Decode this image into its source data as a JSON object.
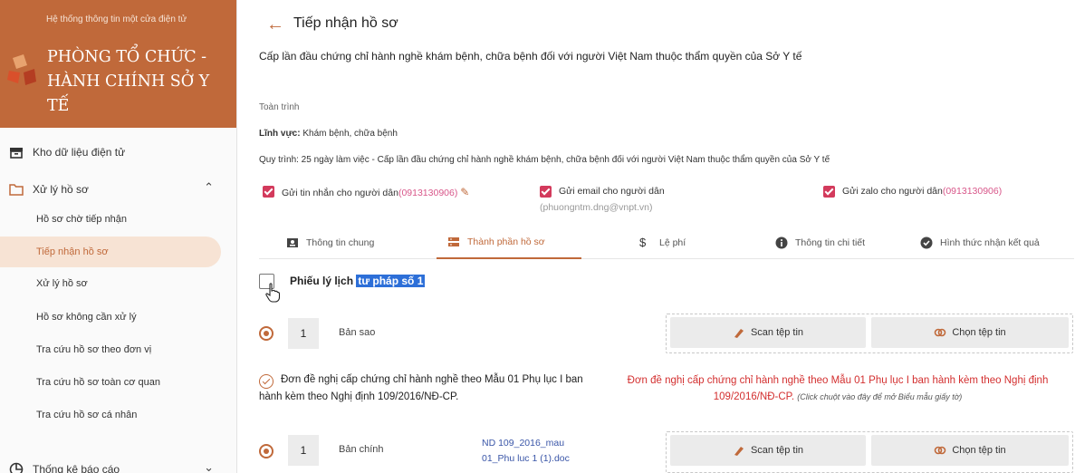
{
  "sidebar": {
    "system_name": "Hệ thống thông tin một cửa điện tử",
    "org_name": "PHÒNG TỔ CHỨC - HÀNH CHÍNH SỞ Y TẾ",
    "items": [
      {
        "label": "Kho dữ liệu điện tử",
        "icon": "archive-icon"
      },
      {
        "label": "Xử lý hồ sơ",
        "icon": "folder-icon",
        "expanded": true,
        "children": [
          {
            "label": "Hồ sơ chờ tiếp nhận"
          },
          {
            "label": "Tiếp nhận hồ sơ",
            "active": true
          },
          {
            "label": "Xử lý hồ sơ"
          },
          {
            "label": "Hồ sơ không cần xử lý"
          },
          {
            "label": "Tra cứu hồ sơ theo đơn vị"
          },
          {
            "label": "Tra cứu hồ sơ toàn cơ quan"
          },
          {
            "label": "Tra cứu hồ sơ cá nhân"
          }
        ]
      },
      {
        "label": "Thống kê báo cáo",
        "icon": "chart-icon"
      }
    ]
  },
  "header": {
    "title": "Tiếp nhận hồ sơ",
    "procedure_title": "Cấp lần đầu chứng chỉ hành nghề khám bệnh, chữa bệnh đối với người Việt Nam thuộc thẩm quyền của Sở Y tế"
  },
  "info": {
    "scope": "Toàn trình",
    "field_label": "Lĩnh vực:",
    "field_value": " Khám bệnh, chữa bệnh",
    "process": "Quy trình: 25 ngày làm việc - Cấp lần đầu chứng chỉ hành nghề khám bệnh, chữa bệnh đối với người Việt Nam thuộc thẩm quyền của Sở Y tế"
  },
  "notify": {
    "sms_label": "Gửi tin nhắn cho người dân",
    "sms_phone": "(0913130906)",
    "email_label": "Gửi email cho người dân",
    "email_value": "(phuongntm.dng@vnpt.vn)",
    "zalo_label": "Gửi zalo cho người dân",
    "zalo_phone": "(0913130906)"
  },
  "tabs": [
    {
      "label": "Thông tin chung",
      "icon": "id-card-icon"
    },
    {
      "label": "Thành phần hồ sơ",
      "icon": "list-icon",
      "active": true
    },
    {
      "label": "Lệ phí",
      "icon": "dollar-icon"
    },
    {
      "label": "Thông tin chi tiết",
      "icon": "info-icon"
    },
    {
      "label": "Hình thức nhận kết quả",
      "icon": "check-badge-icon"
    }
  ],
  "documents": {
    "doc1": {
      "title_prefix": "Phiếu lý lịch ",
      "title_highlight": "tư pháp số 1",
      "quantity": "1",
      "copy_type": "Bản sao"
    },
    "doc2": {
      "title": "Đơn đề nghị cấp chứng chỉ hành nghề theo Mẫu 01 Phụ lục I ban hành kèm theo Nghị định 109/2016/NĐ-CP.",
      "form_link": "Đơn đề nghị cấp chứng chỉ hành nghề theo Mẫu 01 Phụ lục I ban hành kèm theo Nghị định 109/2016/NĐ-CP.",
      "form_hint": "(Click chuột vào đây để mở Biểu mẫu giấy tờ)",
      "quantity": "1",
      "copy_type": "Bản chính",
      "file_name": "ND 109_2016_mau 01_Phu luc 1 (1).doc"
    },
    "scan_label": "Scan tệp tin",
    "choose_label": "Chọn tệp tin"
  },
  "colors": {
    "brand": "#c0693a",
    "checkbox": "#d33a5c",
    "link_red": "#d32f2f",
    "active_bg": "#f7e3d4"
  }
}
